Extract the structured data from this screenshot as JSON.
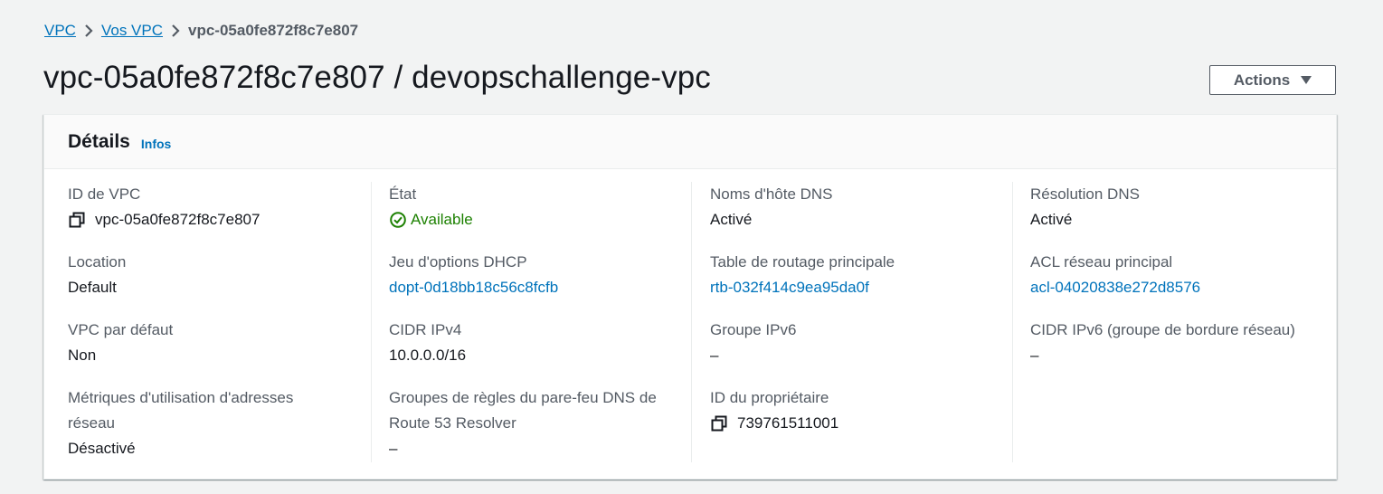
{
  "breadcrumb": {
    "items": [
      "VPC",
      "Vos VPC"
    ],
    "current": "vpc-05a0fe872f8c7e807"
  },
  "page": {
    "title": "vpc-05a0fe872f8c7e807 / devopschallenge-vpc",
    "actions_label": "Actions"
  },
  "details": {
    "title": "Détails",
    "info_label": "Infos",
    "columns": [
      {
        "fields": [
          {
            "label": "ID de VPC",
            "value": "vpc-05a0fe872f8c7e807"
          },
          {
            "label": "Location",
            "value": "Default"
          },
          {
            "label": "VPC par défaut",
            "value": "Non"
          },
          {
            "label": "Métriques d'utilisation d'adresses réseau",
            "value": "Désactivé"
          }
        ]
      },
      {
        "fields": [
          {
            "label": "État",
            "value": "Available"
          },
          {
            "label": "Jeu d'options DHCP",
            "value": "dopt-0d18bb18c56c8fcfb"
          },
          {
            "label": "CIDR IPv4",
            "value": "10.0.0.0/16"
          },
          {
            "label": "Groupes de règles du pare-feu DNS de Route 53 Resolver",
            "value": "–"
          }
        ]
      },
      {
        "fields": [
          {
            "label": "Noms d'hôte DNS",
            "value": "Activé"
          },
          {
            "label": "Table de routage principale",
            "value": "rtb-032f414c9ea95da0f"
          },
          {
            "label": "Groupe IPv6",
            "value": "–"
          },
          {
            "label": "ID du propriétaire",
            "value": "739761511001"
          }
        ]
      },
      {
        "fields": [
          {
            "label": "Résolution DNS",
            "value": "Activé"
          },
          {
            "label": "ACL réseau principal",
            "value": "acl-04020838e272d8576"
          },
          {
            "label": "CIDR IPv6 (groupe de bordure réseau)",
            "value": "–"
          }
        ]
      }
    ]
  },
  "colors": {
    "link": "#0073bb",
    "success": "#1d8102",
    "text": "#16191f",
    "label": "#545b64",
    "background": "#f2f3f3"
  },
  "icons": {
    "copy": "copy-icon",
    "status": "check-circle-icon",
    "breadcrumb_separator": "chevron-right-icon",
    "dropdown": "caret-down-icon"
  }
}
